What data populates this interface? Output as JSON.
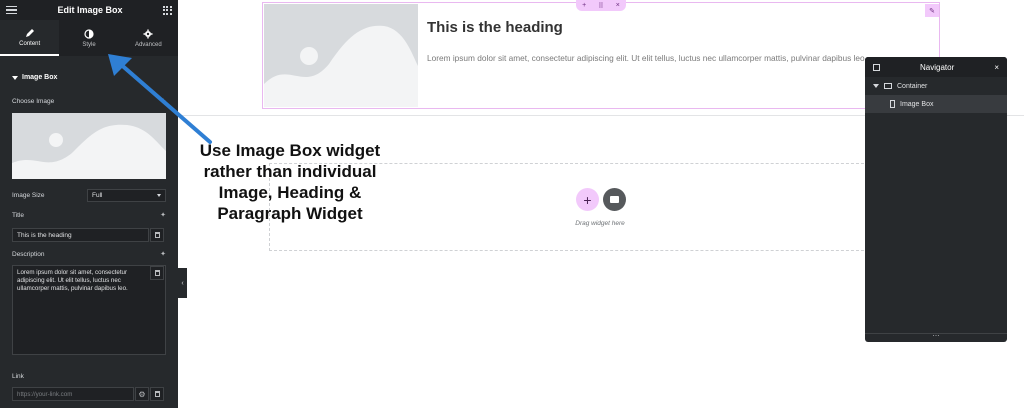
{
  "panel": {
    "title": "Edit Image Box",
    "tabs": [
      {
        "label": "Content",
        "icon": "pencil-icon"
      },
      {
        "label": "Style",
        "icon": "half-circle-icon"
      },
      {
        "label": "Advanced",
        "icon": "gear-icon"
      }
    ],
    "section_title": "Image Box",
    "choose_image_label": "Choose Image",
    "image_size_label": "Image Size",
    "image_size_value": "Full",
    "title_label": "Title",
    "title_value": "This is the heading",
    "description_label": "Description",
    "description_value": "Lorem ipsum dolor sit amet, consectetur adipiscing elit. Ut elit tellus, luctus nec ullamcorper mattis, pulvinar dapibus leo.",
    "link_label": "Link",
    "link_placeholder": "https://your-link.com"
  },
  "canvas": {
    "heading": "This is the heading",
    "description": "Lorem ipsum dolor sit amet, consectetur adipiscing elit. Ut elit tellus, luctus nec ullamcorper mattis, pulvinar dapibus leo.",
    "drag_text": "Drag widget here",
    "toolbar_add": "+",
    "toolbar_move": "⠿",
    "toolbar_close": "×",
    "edit_glyph": "✎",
    "add_glyph": "+"
  },
  "callout": {
    "text": "Use Image Box widget rather than individual Image, Heading & Paragraph Widget"
  },
  "navigator": {
    "title": "Navigator",
    "close_glyph": "×",
    "items": [
      {
        "label": "Container"
      },
      {
        "label": "Image Box"
      }
    ],
    "footer_glyph": "⋯"
  },
  "colors": {
    "panel_bg": "#26292c",
    "accent_pink": "#f2c9fb",
    "arrow_blue": "#2f7fd4"
  }
}
